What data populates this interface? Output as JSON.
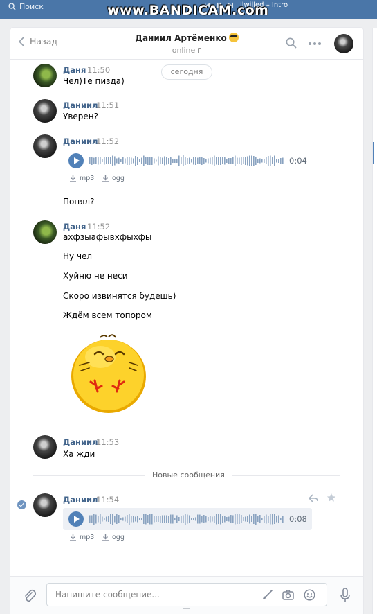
{
  "topbar": {
    "search_label": "Поиск",
    "now_playing": "Illwilled – Intro"
  },
  "watermark": "www.BANDICAM.com",
  "header": {
    "back_label": "Назад",
    "contact_name": "Даниил Артёменко",
    "status": "online"
  },
  "date_badge": "сегодня",
  "messages": [
    {
      "author": "Даня",
      "time": "11:50",
      "lines": [
        "Чел)Те пизда)"
      ]
    },
    {
      "author": "Даниил",
      "time": "11:51",
      "lines": [
        "Уверен?"
      ]
    },
    {
      "author": "Даниил",
      "time": "11:52",
      "audio": {
        "duration": "0:04",
        "dl_mp3": "mp3",
        "dl_ogg": "ogg"
      },
      "lines": [
        "Понял?"
      ]
    },
    {
      "author": "Даня",
      "time": "11:52",
      "lines": [
        "ахфзыафывхфыхфы",
        "Ну чел",
        "Хуйню не неси",
        "Скоро извинятся будешь)",
        "Ждём всем топором"
      ],
      "sticker": "yellow-chick-sticker"
    },
    {
      "author": "Даниил",
      "time": "11:53",
      "lines": [
        "Ха жди"
      ]
    }
  ],
  "new_messages_label": "Новые сообщения",
  "new_message": {
    "author": "Даниил",
    "time": "11:54",
    "audio": {
      "duration": "0:08",
      "dl_mp3": "mp3",
      "dl_ogg": "ogg"
    }
  },
  "composer": {
    "placeholder": "Напишите сообщение..."
  },
  "colors": {
    "accent": "#5181b8",
    "author": "#42648b",
    "topbar": "#4a76a8",
    "background": "#edeef0"
  }
}
